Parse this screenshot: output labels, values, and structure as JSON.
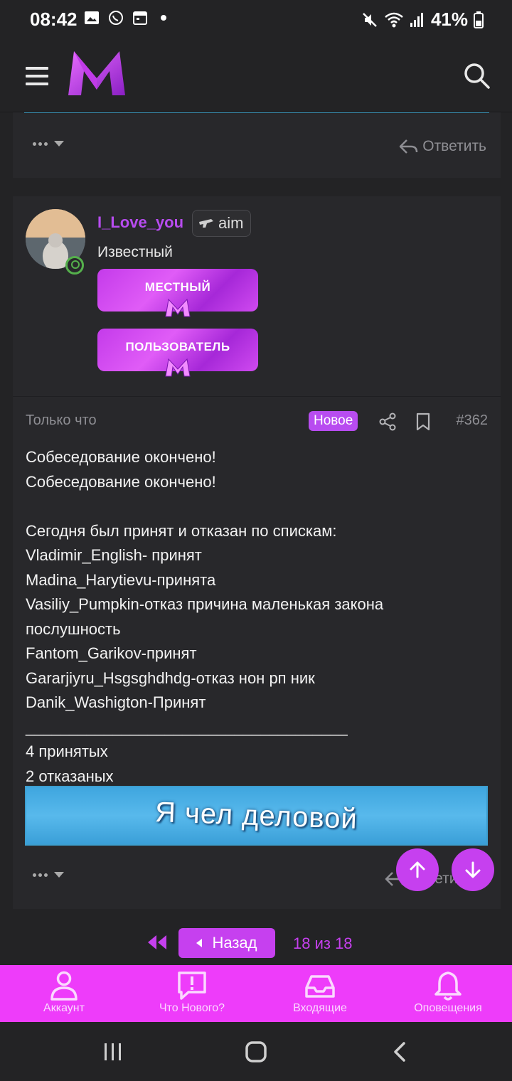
{
  "status_bar": {
    "time": "08:42",
    "battery": "41%"
  },
  "header": {
    "menu_icon": "hamburger-icon",
    "logo_icon": "m-logo-icon",
    "search_icon": "search-icon"
  },
  "prev_post": {
    "reply_label": "Ответить"
  },
  "post": {
    "username": "I_Love_you",
    "tag_label": "aim",
    "user_title": "Известный",
    "banners": [
      "МЕСТНЫЙ",
      "ПОЛЬЗОВАТЕЛЬ"
    ],
    "time": "Только что",
    "new_badge": "Новое",
    "number": "#362",
    "lines": [
      "Собеседование окончено!",
      "Собеседование окончено!",
      "",
      "Сегодня был принят и отказан по спискам:",
      "Vladimir_English- принят",
      "Madina_Harytievu-принята",
      "Vasiliy_Pumpkin-отказ причина маленькая закона",
      "послушность",
      "Fantom_Garikov-принят",
      "Gararjiyru_Hsgsghdhdg-отказ нон рп ник",
      "Danik_Washigton-Принят",
      "_____________________________________",
      "4 принятых",
      "2 отказаных"
    ],
    "image_text": "Я чел деловой",
    "reply_label": "Ответить"
  },
  "pagination": {
    "back_label": "Назад",
    "info": "18 из 18"
  },
  "bottom_nav": [
    {
      "label": "Аккаунт",
      "icon": "user-icon"
    },
    {
      "label": "Что Нового?",
      "icon": "whats-new-icon"
    },
    {
      "label": "Входящие",
      "icon": "inbox-icon"
    },
    {
      "label": "Оповещения",
      "icon": "bell-icon"
    }
  ],
  "colors": {
    "accent": "#c640ef",
    "username": "#b84cf0",
    "background": "#232325",
    "card": "#28282b"
  }
}
